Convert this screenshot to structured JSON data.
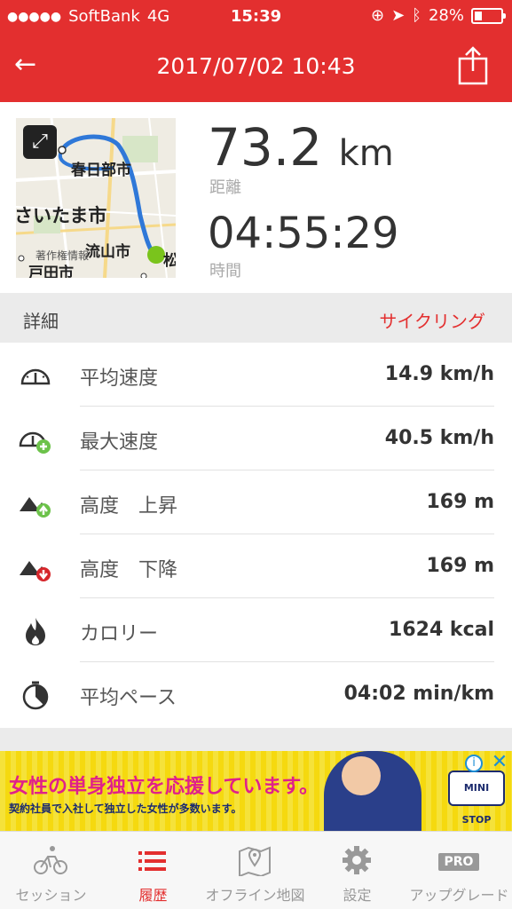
{
  "status_bar": {
    "carrier": "SoftBank",
    "network": "4G",
    "time": "15:39",
    "battery": "28%",
    "battery_level": 0.28
  },
  "nav": {
    "title": "2017/07/02 10:43",
    "back_icon": "arrow-left-icon",
    "share_icon": "share-icon"
  },
  "summary": {
    "distance_value": "73.2",
    "distance_unit": "km",
    "distance_label": "距離",
    "time_value": "04:55:29",
    "time_label": "時間",
    "map": {
      "labels": [
        "春日部市",
        "さいたま市",
        "流山市",
        "戸田市",
        "松"
      ],
      "watermark": "著作権情報",
      "expand_icon": "expand-icon"
    }
  },
  "details": {
    "title": "詳細",
    "activity_type": "サイクリング",
    "rows": [
      {
        "icon": "speedometer-icon",
        "label": "平均速度",
        "value": "14.9 km/h"
      },
      {
        "icon": "speedometer-plus-icon",
        "label": "最大速度",
        "value": "40.5 km/h"
      },
      {
        "icon": "mountain-up-icon",
        "label": "高度　上昇",
        "value": "169 m"
      },
      {
        "icon": "mountain-down-icon",
        "label": "高度　下降",
        "value": "169 m"
      },
      {
        "icon": "flame-icon",
        "label": "カロリー",
        "value": "1624 kcal"
      },
      {
        "icon": "stopwatch-icon",
        "label": "平均ペース",
        "value": "04:02 min/km"
      }
    ]
  },
  "ad": {
    "headline": "女性の単身独立を応援しています。",
    "sub": "契約社員で入社して独立した女性が多数います。",
    "logo": "MINI STOP",
    "info": "i",
    "close": "✕"
  },
  "tabs": [
    {
      "label": "セッション",
      "icon": "cyclist-icon",
      "active": false
    },
    {
      "label": "履歴",
      "icon": "list-icon",
      "active": true
    },
    {
      "label": "オフライン地図",
      "icon": "map-pin-icon",
      "active": false
    },
    {
      "label": "設定",
      "icon": "gear-icon",
      "active": false
    },
    {
      "label": "アップグレード",
      "icon": "pro-icon",
      "badge": "PRO",
      "active": false
    }
  ],
  "colors": {
    "brand_red": "#e32f2f",
    "up_green": "#6cc24a",
    "down_red": "#d6262b",
    "ad_yellow": "#f5d90f"
  }
}
